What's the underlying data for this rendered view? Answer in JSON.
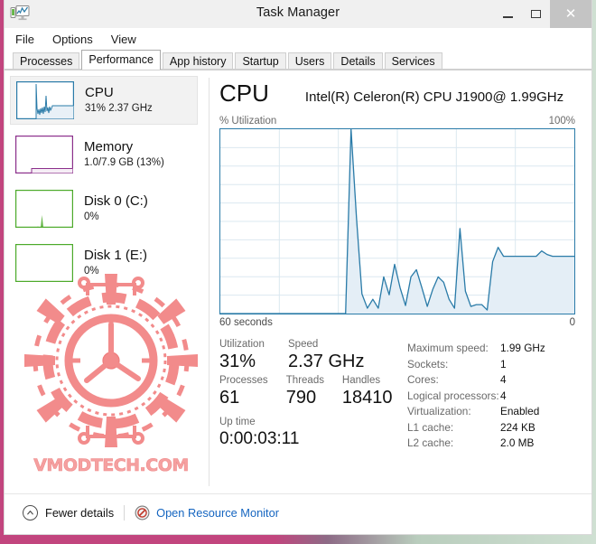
{
  "window": {
    "title": "Task Manager",
    "icon": "task-manager-icon",
    "minimize_label": "–",
    "maximize_label": "□",
    "close_label": "✕"
  },
  "menu": {
    "items": [
      {
        "label": "File"
      },
      {
        "label": "Options"
      },
      {
        "label": "View"
      }
    ]
  },
  "tabs": {
    "items": [
      {
        "label": "Processes",
        "active": false
      },
      {
        "label": "Performance",
        "active": true
      },
      {
        "label": "App history",
        "active": false
      },
      {
        "label": "Startup",
        "active": false
      },
      {
        "label": "Users",
        "active": false
      },
      {
        "label": "Details",
        "active": false
      },
      {
        "label": "Services",
        "active": false
      }
    ]
  },
  "sidebar": {
    "items": [
      {
        "name": "cpu",
        "title": "CPU",
        "sub": "31%  2.37 GHz",
        "color": "#2a7ba8",
        "selected": true
      },
      {
        "name": "memory",
        "title": "Memory",
        "sub": "1.0/7.9 GB (13%)",
        "color": "#8b2f8b",
        "selected": false
      },
      {
        "name": "disk0",
        "title": "Disk 0 (C:)",
        "sub": "0%",
        "color": "#4caa2a",
        "selected": false
      },
      {
        "name": "disk1",
        "title": "Disk 1 (E:)",
        "sub": "0%",
        "color": "#4caa2a",
        "selected": false
      }
    ]
  },
  "watermark": {
    "text": "VMODTECH.COM",
    "color": "#f28b8b"
  },
  "main": {
    "heading": "CPU",
    "model": "Intel(R) Celeron(R) CPU J1900@ 1.99GHz",
    "graph_top_left_label": "% Utilization",
    "graph_top_right_label": "100%",
    "graph_bottom_left_label": "60 seconds",
    "graph_bottom_right_label": "0",
    "stats": {
      "utilization_label": "Utilization",
      "utilization_value": "31%",
      "speed_label": "Speed",
      "speed_value": "2.37 GHz",
      "processes_label": "Processes",
      "processes_value": "61",
      "threads_label": "Threads",
      "threads_value": "790",
      "handles_label": "Handles",
      "handles_value": "18410",
      "uptime_label": "Up time",
      "uptime_value": "0:00:03:11"
    },
    "specs": [
      {
        "key": "Maximum speed:",
        "value": "1.99 GHz"
      },
      {
        "key": "Sockets:",
        "value": "1"
      },
      {
        "key": "Cores:",
        "value": "4"
      },
      {
        "key": "Logical processors:",
        "value": "4"
      },
      {
        "key": "Virtualization:",
        "value": "Enabled"
      },
      {
        "key": "L1 cache:",
        "value": "224 KB"
      },
      {
        "key": "L2 cache:",
        "value": "2.0 MB"
      }
    ]
  },
  "footer": {
    "fewer_details_label": "Fewer details",
    "fewer_details_icon": "chevron-up-icon",
    "resource_monitor_label": "Open Resource Monitor",
    "resource_monitor_icon": "resource-monitor-icon"
  },
  "chart_data": {
    "type": "area",
    "title": "% Utilization",
    "xlabel": "60 seconds",
    "ylabel": "% Utilization",
    "ylim": [
      0,
      100
    ],
    "xlim": [
      60,
      0
    ],
    "grid": true,
    "grid_rows": 10,
    "grid_cols": 6,
    "line_color": "#2a7ba8",
    "fill_color": "#dfeaf4",
    "y_axis_top_label": "100%",
    "y_axis_bottom_label": "0",
    "x_axis_left_label": "60 seconds",
    "x_axis_right_label": "0",
    "series": [
      {
        "name": "CPU utilization",
        "x": [
          60,
          59,
          58,
          57,
          56,
          55,
          54,
          53,
          52,
          51,
          50,
          49,
          48,
          47,
          46,
          45,
          44,
          43,
          42,
          41,
          40,
          39,
          38,
          37,
          36,
          35,
          34,
          33,
          32,
          31,
          30,
          29,
          28,
          27,
          26,
          25,
          24,
          23,
          22,
          21,
          20,
          19,
          18,
          17,
          16,
          15,
          14,
          13,
          12,
          11,
          10,
          9,
          8,
          7,
          6,
          5,
          4,
          3,
          2,
          1,
          0
        ],
        "values": [
          0,
          0,
          0,
          0,
          0,
          0,
          0,
          0,
          0,
          0,
          0,
          0,
          0,
          0,
          0,
          0,
          0,
          0,
          0,
          0,
          0,
          0,
          0,
          100,
          52,
          11,
          3,
          8,
          3,
          17,
          6,
          30,
          22,
          12,
          4,
          20,
          24,
          14,
          4,
          13,
          20,
          17,
          8,
          4,
          46,
          12,
          4,
          5,
          5,
          2,
          28,
          36,
          31,
          31,
          31,
          31,
          31,
          31,
          34,
          32,
          31
        ]
      }
    ]
  }
}
